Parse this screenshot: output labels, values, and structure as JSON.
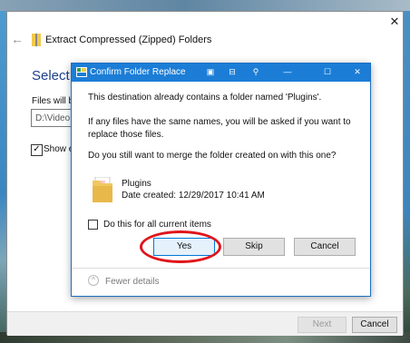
{
  "wizard": {
    "title": "Extract Compressed (Zipped) Folders",
    "heading": "Select a",
    "files_label": "Files will be",
    "path_value": "D:\\Video",
    "show_label": "Show e",
    "next_label": "Next",
    "cancel_label": "Cancel"
  },
  "dialog": {
    "title": "Confirm Folder Replace",
    "message1": "This destination already contains a folder named 'Plugins'.",
    "message2": "If any files have the same names, you will be asked if you want to replace those files.",
    "message3": "Do you still want to merge the folder created on  with this one?",
    "folder_name": "Plugins",
    "folder_date": "Date created: 12/29/2017 10:41 AM",
    "checkbox_label": "Do this for all current items",
    "yes_label": "Yes",
    "skip_label": "Skip",
    "cancel_label": "Cancel",
    "fewer_details_label": "Fewer details"
  },
  "colors": {
    "titlebar": "#1b7dd6",
    "heading": "#1c3f8a",
    "annotation": "#e0161b"
  },
  "icons": [
    "back-arrow-icon",
    "zip-folder-icon",
    "close-icon",
    "app-icon",
    "folder-icon",
    "chevron-up-icon"
  ]
}
